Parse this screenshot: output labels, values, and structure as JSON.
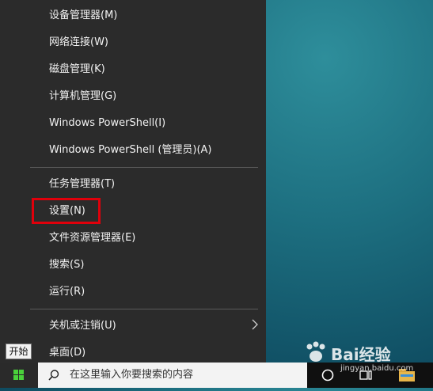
{
  "menu": {
    "items": [
      {
        "label": "设备管理器(M)"
      },
      {
        "label": "网络连接(W)"
      },
      {
        "label": "磁盘管理(K)"
      },
      {
        "label": "计算机管理(G)"
      },
      {
        "label": "Windows PowerShell(I)"
      },
      {
        "label": "Windows PowerShell (管理员)(A)"
      },
      {
        "label": "任务管理器(T)"
      },
      {
        "label": "设置(N)"
      },
      {
        "label": "文件资源管理器(E)"
      },
      {
        "label": "搜索(S)"
      },
      {
        "label": "运行(R)"
      },
      {
        "label": "关机或注销(U)"
      },
      {
        "label": "桌面(D)"
      }
    ],
    "highlight_color": "#e0000b"
  },
  "tooltip": {
    "text": "开始"
  },
  "taskbar": {
    "search_placeholder": "在这里输入你要搜索的内容"
  },
  "watermark": {
    "brand": "Bai",
    "brand2": "经验",
    "url": "jingyan.baidu.com"
  },
  "colors": {
    "menu_bg": "#2b2b2b",
    "taskbar_bg": "#101010",
    "windows_logo": "#4ad13b"
  }
}
